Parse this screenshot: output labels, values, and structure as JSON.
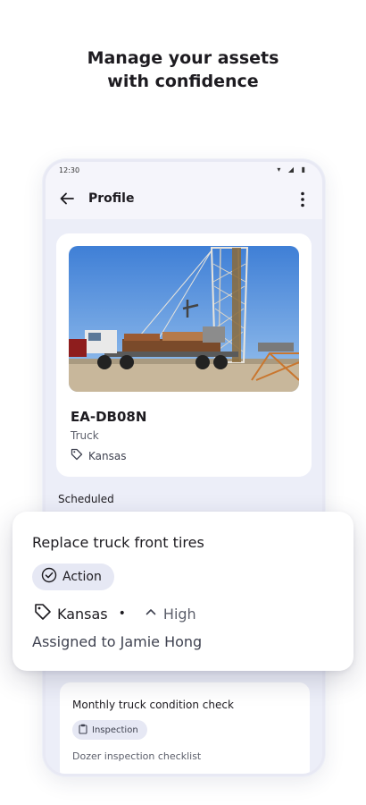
{
  "headline": {
    "line1": "Manage your assets",
    "line2": "with confidence"
  },
  "status_bar": {
    "time": "12:30"
  },
  "app_bar": {
    "title": "Profile"
  },
  "asset": {
    "id": "EA-DB08N",
    "type": "Truck",
    "location": "Kansas"
  },
  "section": {
    "scheduled_label": "Scheduled"
  },
  "featured_task": {
    "title": "Replace truck front tires",
    "category": "Action",
    "location": "Kansas",
    "priority": "High",
    "assignee": "Assigned to Jamie Hong"
  },
  "second_task": {
    "title": "Monthly truck condition check",
    "category": "Inspection",
    "checklist": "Dozer inspection checklist"
  },
  "colors": {
    "background": "#ffffff",
    "screen": "#eceef8",
    "chip": "#e6e8f4",
    "text": "#1d1b20"
  },
  "icons": [
    "back-arrow-icon",
    "more-vert-icon",
    "tag-icon",
    "check-circle-icon",
    "chevron-up-icon",
    "clipboard-icon"
  ]
}
